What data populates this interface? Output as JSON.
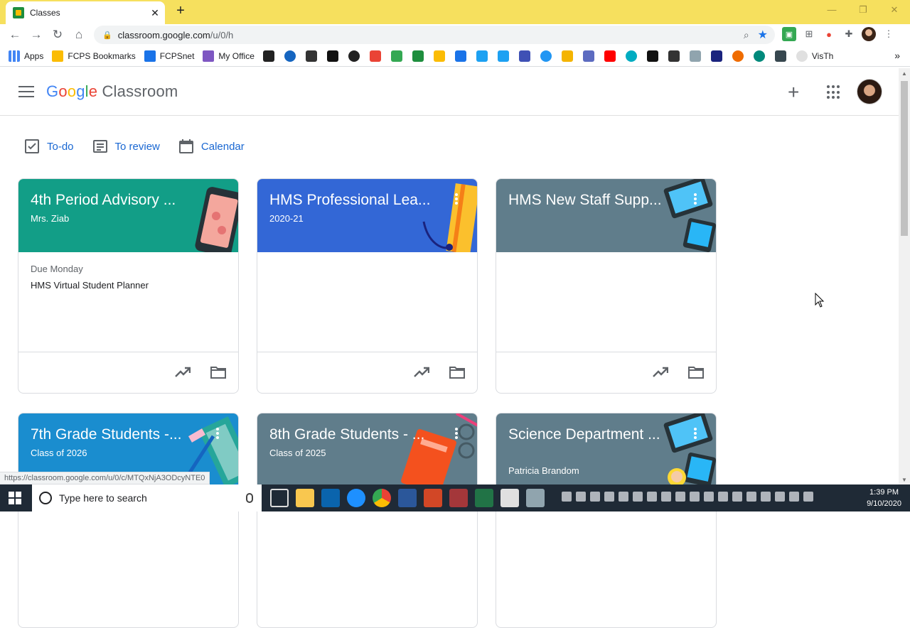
{
  "browser": {
    "tab_title": "Classes",
    "tab_close": "✕",
    "new_tab": "+",
    "url_host": "classroom.google.com",
    "url_path": "/u/0/h",
    "window_controls": [
      "—",
      "❐",
      "✕"
    ],
    "bookmarks": [
      {
        "label": "Apps",
        "color": "#4285f4"
      },
      {
        "label": "FCPS Bookmarks",
        "color": "#fbbc04"
      },
      {
        "label": "FCPSnet",
        "color": "#1a73e8"
      },
      {
        "label": "My Office",
        "color": "#7e57c2"
      }
    ],
    "bookmark_more": "»",
    "bookmark_extra_label": "VisTh",
    "status_url": "https://classroom.google.com/u/0/c/MTQxNjA3ODcyNTE0"
  },
  "header": {
    "brand_google": "Google",
    "brand_product": "Classroom"
  },
  "subnav": {
    "todo": "To-do",
    "to_review": "To review",
    "calendar": "Calendar"
  },
  "cards": [
    {
      "title": "4th Period Advisory ...",
      "subtitle": "Mrs. Ziab",
      "color": "#129e87",
      "due_label": "Due Monday",
      "due_item": "HMS Virtual Student Planner"
    },
    {
      "title": "HMS Professional Lea...",
      "subtitle": "2020-21",
      "color": "#3367d6",
      "due_label": "",
      "due_item": ""
    },
    {
      "title": "HMS New Staff Supp...",
      "subtitle": "",
      "color": "#607d8b",
      "due_label": "",
      "due_item": ""
    },
    {
      "title": "7th Grade Students -...",
      "subtitle": "Class of 2026",
      "color": "#1a8dcf"
    },
    {
      "title": "8th Grade Students - ...",
      "subtitle": "Class of 2025",
      "color": "#607d8b"
    },
    {
      "title": "Science Department ...",
      "subtitle": "Patricia Brandom",
      "color": "#607d8b"
    }
  ],
  "taskbar": {
    "search_placeholder": "Type here to search",
    "time": "1:39 PM",
    "date": "9/10/2020"
  }
}
